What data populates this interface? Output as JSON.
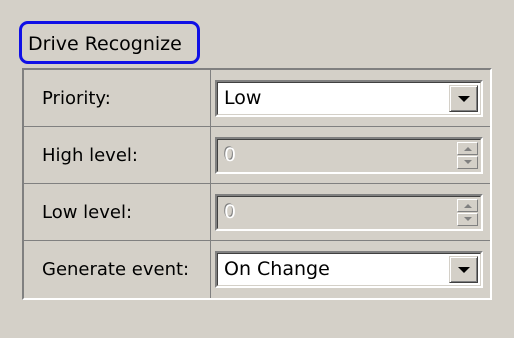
{
  "group": {
    "title": "Drive Recognize"
  },
  "colors": {
    "highlight_outline": "#1010e6",
    "window_background": "#d4d0c8"
  },
  "fields": [
    {
      "label": "Priority:",
      "value": "Low",
      "control": "dropdown",
      "enabled": true,
      "icon": "chevron-down-icon"
    },
    {
      "label": "High level:",
      "value": "0",
      "control": "spin",
      "enabled": false,
      "icon": "spin-arrows-icon"
    },
    {
      "label": "Low level:",
      "value": "0",
      "control": "spin",
      "enabled": false,
      "icon": "spin-arrows-icon"
    },
    {
      "label": "Generate event:",
      "value": "On Change",
      "control": "dropdown",
      "enabled": true,
      "icon": "chevron-down-icon"
    }
  ]
}
